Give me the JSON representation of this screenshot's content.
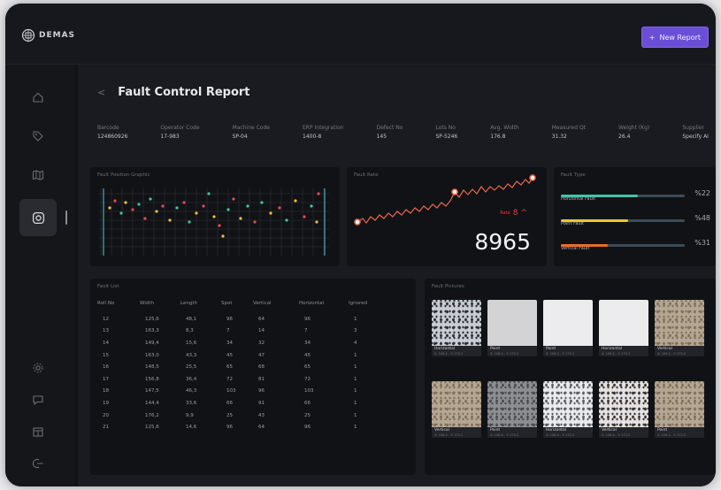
{
  "app": {
    "logo_text": "DEMAS"
  },
  "header": {
    "new_report_label": "New Report",
    "new_report_icon": "plus-icon"
  },
  "sidebar": {
    "items": [
      {
        "name": "home",
        "icon": "home-icon"
      },
      {
        "name": "tag",
        "icon": "tag-icon"
      },
      {
        "name": "map",
        "icon": "map-icon"
      },
      {
        "name": "fault-control",
        "icon": "camera-icon",
        "active": true
      },
      {
        "name": "settings",
        "icon": "gear-icon"
      },
      {
        "name": "support",
        "icon": "chat-icon"
      },
      {
        "name": "calendar",
        "icon": "calendar-icon"
      },
      {
        "name": "logout",
        "icon": "logout-icon"
      }
    ]
  },
  "page": {
    "title": "Fault Control Report"
  },
  "info": [
    {
      "label": "Barcode",
      "value": "124860926"
    },
    {
      "label": "Operator Code",
      "value": "17-983"
    },
    {
      "label": "Machine Code",
      "value": "SP-04"
    },
    {
      "label": "ERP Integration",
      "value": "1400-8"
    },
    {
      "label": "Defect No",
      "value": "145"
    },
    {
      "label": "Lots No",
      "value": "SP-5246"
    },
    {
      "label": "Avg. Width",
      "value": "176.8"
    },
    {
      "label": "Measured Qt",
      "value": "31.32"
    },
    {
      "label": "Weight (Kg)",
      "value": "26.4"
    },
    {
      "label": "Supplier",
      "value": "Specify AI"
    }
  ],
  "fault_position": {
    "title": "Fault Position Graphic"
  },
  "fault_rate": {
    "title": "Fault Rate",
    "rate_label": "Rate",
    "rate_value": "8",
    "total": "8965"
  },
  "fault_type": {
    "title": "Fault Type",
    "items": [
      {
        "name": "Horizontal Fault",
        "value": "%22",
        "fraction": 0.62,
        "color": "#3fc6a8"
      },
      {
        "name": "Point Fault",
        "value": "%48",
        "fraction": 0.54,
        "color": "#f0c23b"
      },
      {
        "name": "Vertical Fault",
        "value": "%31",
        "fraction": 0.38,
        "color": "#ee6a2a"
      }
    ]
  },
  "fault_list": {
    "title": "Fault List",
    "columns": [
      "Roll No",
      "Width",
      "Length",
      "Spot",
      "Vertical",
      "Horizontal",
      "Ignored"
    ],
    "rows": [
      [
        "12",
        "125,6",
        "48,1",
        "96",
        "64",
        "96",
        "1"
      ],
      [
        "13",
        "163,3",
        "8,3",
        "7",
        "14",
        "7",
        "3"
      ],
      [
        "14",
        "149,4",
        "15,6",
        "34",
        "32",
        "34",
        "4"
      ],
      [
        "15",
        "163,0",
        "43,3",
        "45",
        "47",
        "45",
        "1"
      ],
      [
        "16",
        "148,5",
        "25,5",
        "65",
        "68",
        "65",
        "1"
      ],
      [
        "17",
        "156,8",
        "36,4",
        "72",
        "81",
        "72",
        "1"
      ],
      [
        "18",
        "147,5",
        "46,3",
        "103",
        "96",
        "103",
        "1"
      ],
      [
        "19",
        "144,4",
        "33,6",
        "66",
        "91",
        "66",
        "1"
      ],
      [
        "20",
        "176,2",
        "9,9",
        "25",
        "43",
        "25",
        "1"
      ],
      [
        "21",
        "125,6",
        "14,6",
        "96",
        "64",
        "96",
        "1"
      ]
    ]
  },
  "fault_pictures": {
    "title": "Fault Pictures",
    "items": [
      {
        "label": "Horizontal",
        "sub": "X: 106.4 - Y: 170.2",
        "tone": "spots-dark"
      },
      {
        "label": "Point",
        "sub": "X: 106.4 - Y: 170.2",
        "tone": "plain-light"
      },
      {
        "label": "Point",
        "sub": "X: 106.4 - Y: 170.2",
        "tone": "plain-white"
      },
      {
        "label": "Horizontal",
        "sub": "X: 106.4 - Y: 170.2",
        "tone": "plain-white"
      },
      {
        "label": "Vertical",
        "sub": "X: 106.4 - Y: 170.2",
        "tone": "beige-rough"
      },
      {
        "label": "Vertical",
        "sub": "X: 106.4 - Y: 170.2",
        "tone": "beige-rough"
      },
      {
        "label": "Point",
        "sub": "X: 106.4 - Y: 170.2",
        "tone": "grey-speckle"
      },
      {
        "label": "Horizontal",
        "sub": "X: 106.4 - Y: 170.2",
        "tone": "spots-light"
      },
      {
        "label": "Vertical",
        "sub": "X: 106.4 - Y: 170.2",
        "tone": "white-dark"
      },
      {
        "label": "Point",
        "sub": "X: 106.4 - Y: 170.2",
        "tone": "beige-rough"
      }
    ]
  }
}
